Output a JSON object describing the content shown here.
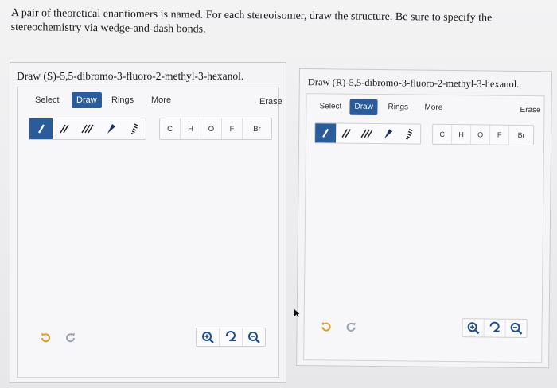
{
  "question": {
    "text": "A pair of theoretical enantiomers is named. For each stereoisomer, draw the structure. Be sure to specify the stereochemistry via wedge-and-dash bonds."
  },
  "panels": [
    {
      "title": "Draw (S)-5,5-dibromo-3-fluoro-2-methyl-3-hexanol.",
      "tabs": [
        "Select",
        "Draw",
        "Rings",
        "More"
      ],
      "active_tab": "Draw",
      "erase_label": "Erase",
      "bond_tools": [
        "single-bond",
        "double-bond",
        "triple-bond",
        "wedge-bond",
        "dash-bond"
      ],
      "selected_bond": "single-bond",
      "atoms": [
        "C",
        "H",
        "O",
        "F",
        "Br"
      ]
    },
    {
      "title": "Draw (R)-5,5-dibromo-3-fluoro-2-methyl-3-hexanol.",
      "tabs": [
        "Select",
        "Draw",
        "Rings",
        "More"
      ],
      "active_tab": "Draw",
      "erase_label": "Erase",
      "bond_tools": [
        "single-bond",
        "double-bond",
        "triple-bond",
        "wedge-bond",
        "dash-bond"
      ],
      "selected_bond": "single-bond",
      "atoms": [
        "C",
        "H",
        "O",
        "F",
        "Br"
      ]
    }
  ],
  "colors": {
    "accent": "#2a5b9a",
    "icon_orange": "#e09a2a",
    "icon_gray": "#9aa4b0",
    "icon_blue": "#2a5b9a"
  }
}
